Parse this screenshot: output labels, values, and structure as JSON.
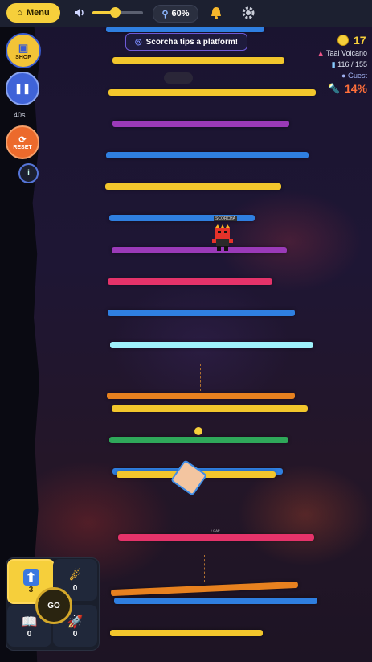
{
  "topbar": {
    "menu_label": "Menu",
    "volume_level": 0.45,
    "zoom_label": "60%"
  },
  "left": {
    "shop_label": "SHOP",
    "timer": "40s",
    "reset_label": "RESET"
  },
  "banner": {
    "text": "Scorcha tips a platform!"
  },
  "hud": {
    "coins": "17",
    "location": "Taal Volcano",
    "progress": "116 / 155",
    "player": "Guest",
    "percent": "14%"
  },
  "gap_label": "↑ GAP",
  "player_tag": "SCORCHA",
  "powerups": [
    {
      "count": "3"
    },
    {
      "count": "0"
    },
    {
      "count": "0"
    },
    {
      "count": "0"
    }
  ],
  "go_label": "GO",
  "colors": {
    "accent": "#f6cf3b",
    "danger": "#ff6f3a"
  }
}
